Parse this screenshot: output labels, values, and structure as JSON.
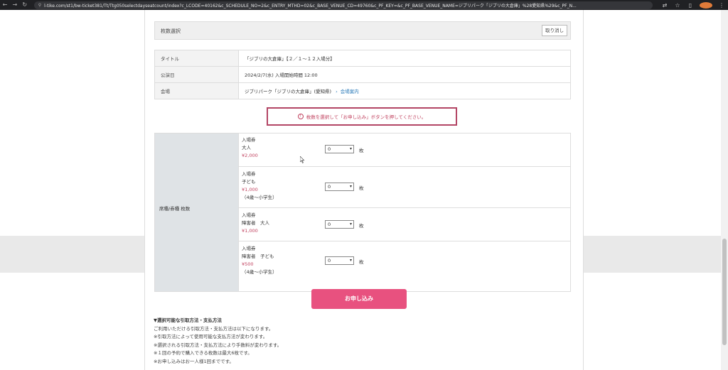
{
  "browser": {
    "url": "l-tike.com/st1/bw-ticket381/Tt/Ttg050selectdayseatcount/index?c_LCODE=40162&c_SCHEDULE_NO=2&c_ENTRY_MTHD=02&c_BASE_VENUE_CD=49760&c_PF_KEY=&c_PF_BASE_VENUE_NAME=ジブリパーク「ジブリの大倉庫」%28愛知県%29&c_PF_N..."
  },
  "section": {
    "title": "枚数選択",
    "reset_label": "取り消し"
  },
  "info": [
    {
      "label": "タイトル",
      "value": "「ジブリの大倉庫」【２／１～１２入場分】"
    },
    {
      "label": "公演日",
      "value": "2024/2/7(水) 入場開始時間 12:00"
    },
    {
      "label": "会場",
      "value": "ジブリパーク「ジブリの大倉庫」(愛知県)",
      "link": "会場案内"
    }
  ],
  "notice": "枚数を選択して「お申し込み」ボタンを押してください。",
  "tickets": {
    "label": "席種/券種 枚数",
    "unit": "枚",
    "items": [
      {
        "line1": "入場券",
        "line2": "大人",
        "price": "¥2,000",
        "note": "",
        "qty": "0"
      },
      {
        "line1": "入場券",
        "line2": "子ども",
        "price": "¥1,000",
        "note": "（4歳～小学生）",
        "qty": "0"
      },
      {
        "line1": "入場券",
        "line2": "障害者　大人",
        "price": "¥1,000",
        "note": "",
        "qty": "0"
      },
      {
        "line1": "入場券",
        "line2": "障害者　子ども",
        "price": "¥500",
        "note": "（4歳～小学生）",
        "qty": "0"
      }
    ]
  },
  "apply_label": "お申し込み",
  "payment": {
    "heading": "▼選択可能な引取方法・支払方法",
    "lines": [
      "ご利用いただける引取方法・支払方法は以下になります。",
      "※引取方法によって使用可能な支払方法が変わります。",
      "※選択される引取方法・支払方法により手数料が変わります。",
      "※１回の予約で購入できる枚数は最大6枚です。",
      "※お申し込みはお一人様1回までです。"
    ]
  },
  "colors": {
    "accent": "#e8517f",
    "price": "#c0415e",
    "notice_border": "#b34565",
    "link": "#2b7bb9"
  }
}
